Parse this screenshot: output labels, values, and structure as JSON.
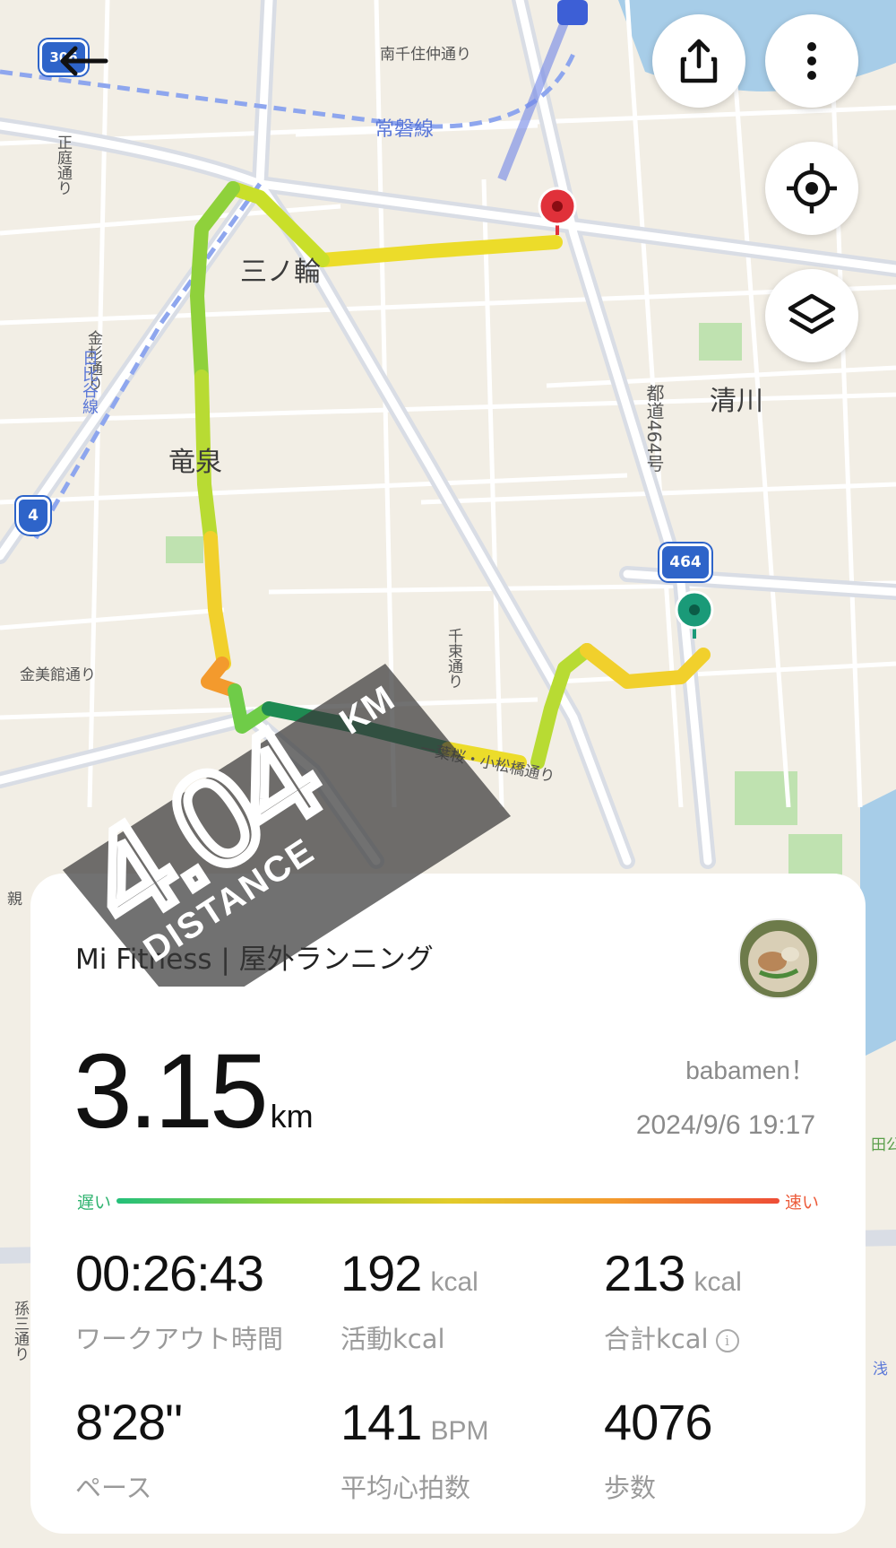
{
  "map": {
    "place_labels": {
      "minowa": "三ノ輪",
      "ryusen": "竜泉",
      "kiyokawa": "清川",
      "minamisenju": "南千住仲通り",
      "joban": "常磐線",
      "shotei": "正庭通り",
      "kanasugi": "金杉通り",
      "hibiya": "日比谷線",
      "toudou": "都道464号",
      "senzoku": "千束通り",
      "kinbikan": "金美館通り",
      "ichiyo": "一葉桜・小松橋通り",
      "oya": "親",
      "mago": "孫三通り",
      "asa": "浅",
      "den": "田公"
    },
    "shields": {
      "route4": "4",
      "route464": "464",
      "route306": "306"
    }
  },
  "overlay": {
    "distance": "4.04",
    "unit": "KM",
    "label": "DISTANCE"
  },
  "card": {
    "app_title": "Mi Fitness | 屋外ランニング",
    "distance_value": "3.15",
    "distance_unit": "km",
    "username": "babamen！",
    "datetime": "2024/9/6 19:17",
    "legend_slow": "遅い",
    "legend_fast": "速い",
    "stats": {
      "workout_time": {
        "value": "00:26:43",
        "label": "ワークアウト時間"
      },
      "active_kcal": {
        "value": "192",
        "unit": "kcal",
        "label": "活動kcal"
      },
      "total_kcal": {
        "value": "213",
        "unit": "kcal",
        "label": "合計kcal"
      },
      "pace": {
        "value": "8'28\"",
        "label": "ペース"
      },
      "heart_rate": {
        "value": "141",
        "unit": "BPM",
        "label": "平均心拍数"
      },
      "steps": {
        "value": "4076",
        "label": "歩数"
      }
    }
  },
  "icons": {
    "back": "back-arrow-icon",
    "share": "share-icon",
    "more": "more-vertical-icon",
    "locate": "locate-icon",
    "layers": "layers-icon",
    "info": "info-icon"
  },
  "colors": {
    "route_slow": "#24c07a",
    "route_mid": "#e2d22a",
    "route_fast": "#ee4d36",
    "start_pin": "#1a9a78",
    "end_pin": "#e0313a"
  }
}
